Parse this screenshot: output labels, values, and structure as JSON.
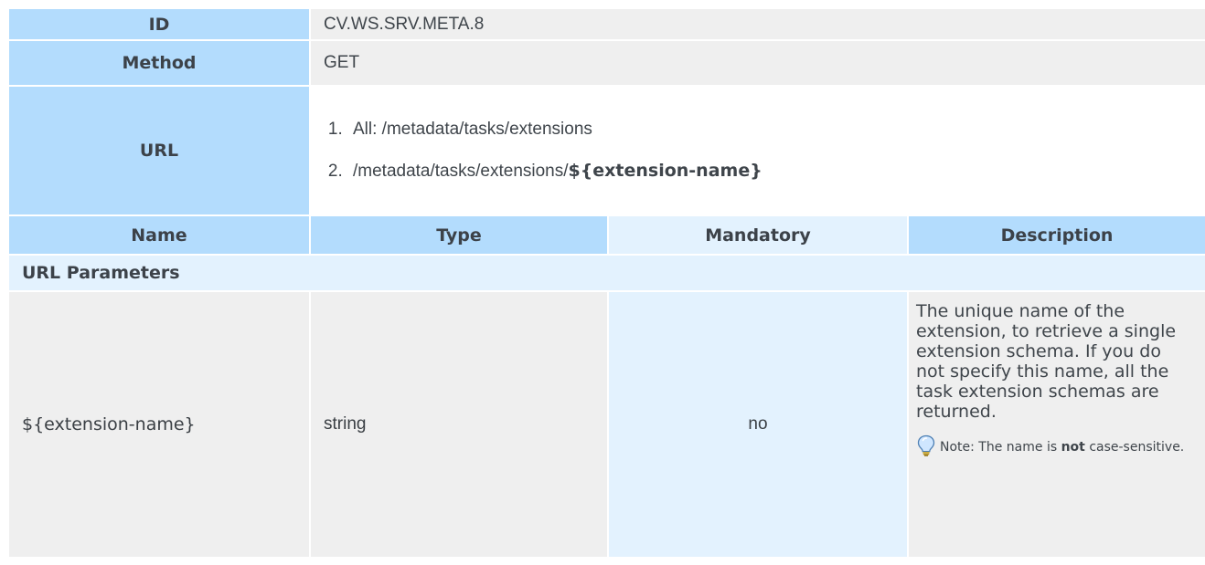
{
  "rows": {
    "id": {
      "label": "ID",
      "value": "CV.WS.SRV.META.8"
    },
    "method": {
      "label": "Method",
      "value": "GET"
    },
    "url": {
      "label": "URL",
      "items": [
        {
          "text": "All: /metadata/tasks/extensions"
        },
        {
          "prefix": "/metadata/tasks/extensions/",
          "bold": "${extension-name}"
        }
      ]
    }
  },
  "columns": {
    "name": "Name",
    "type": "Type",
    "mandatory": "Mandatory",
    "description": "Description"
  },
  "section_title": "URL Parameters",
  "params": [
    {
      "name": "${extension-name}",
      "type": "string",
      "mandatory": "no",
      "description": "The unique name of the extension, to retrieve a single extension schema. If you do not specify this name, all the task extension schemas are returned.",
      "note": {
        "prefix": "Note: The name is ",
        "bold": "not",
        "suffix": " case-sensitive.",
        "icon": "lightbulb-icon"
      }
    }
  ],
  "colors": {
    "header_bg": "#b3dcfd",
    "light_blue_bg": "#e3f2fe",
    "grey_bg": "#efefef"
  }
}
